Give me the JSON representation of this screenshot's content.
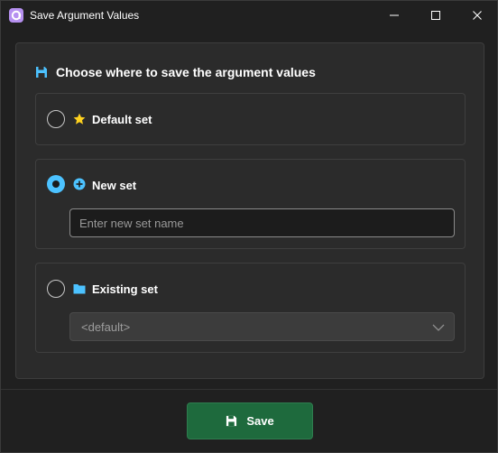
{
  "window": {
    "title": "Save Argument Values",
    "accent_color": "#4cc2ff",
    "save_button_color": "#1e6a3d"
  },
  "dialog": {
    "heading": "Choose where to save the argument values",
    "heading_icon": "floppy-disk-icon",
    "options": [
      {
        "label": "Default set",
        "icon": "star-icon",
        "selected": false
      },
      {
        "label": "New set",
        "icon": "plus-circle-icon",
        "selected": true,
        "input_placeholder": "Enter new set name",
        "input_value": ""
      },
      {
        "label": "Existing set",
        "icon": "folder-icon",
        "selected": false,
        "dropdown_value": "<default>",
        "dropdown_disabled": true
      }
    ]
  },
  "footer": {
    "save_label": "Save",
    "save_icon": "floppy-disk-icon"
  }
}
